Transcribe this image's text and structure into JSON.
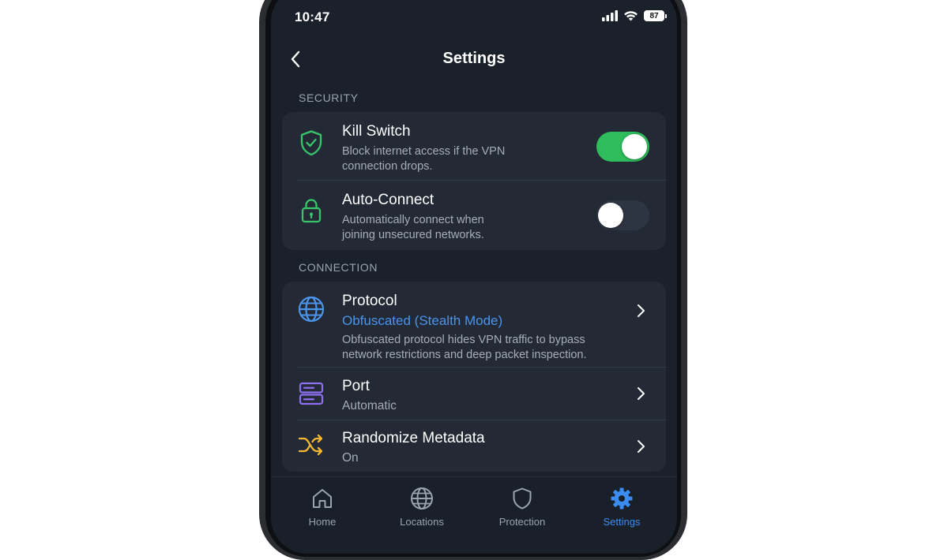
{
  "status_bar": {
    "time": "10:47",
    "battery": "87"
  },
  "header": {
    "title": "Settings"
  },
  "sections": {
    "security": {
      "label": "SECURITY",
      "kill_switch": {
        "title": "Kill Switch",
        "desc_line1": "Block internet access if the VPN",
        "desc_line2": "connection drops.",
        "enabled": true
      },
      "auto_connect": {
        "title": "Auto-Connect",
        "desc_line1": "Automatically connect when",
        "desc_line2": "joining unsecured networks.",
        "enabled": false
      }
    },
    "connection": {
      "label": "CONNECTION",
      "protocol": {
        "title": "Protocol",
        "value": "Obfuscated (Stealth Mode)",
        "desc_line1": "Obfuscated protocol hides VPN traffic to bypass",
        "desc_line2": "network restrictions and deep packet inspection."
      },
      "port": {
        "title": "Port",
        "value": "Automatic"
      },
      "randomize_metadata": {
        "title": "Randomize Metadata",
        "value": "On"
      }
    }
  },
  "tabbar": {
    "tabs": [
      {
        "label": "Home",
        "icon": "home-icon",
        "active": false
      },
      {
        "label": "Locations",
        "icon": "globe-icon",
        "active": false
      },
      {
        "label": "Protection",
        "icon": "shield-icon",
        "active": false
      },
      {
        "label": "Settings",
        "icon": "gear-icon",
        "active": true
      }
    ]
  },
  "colors": {
    "background": "#1b212b",
    "card": "#232a35",
    "accent_blue": "#3b8cf0",
    "toggle_on": "#2fbd5c",
    "icon_green": "#37c46a",
    "icon_purple": "#8d6ff0",
    "icon_yellow": "#f4b731"
  }
}
